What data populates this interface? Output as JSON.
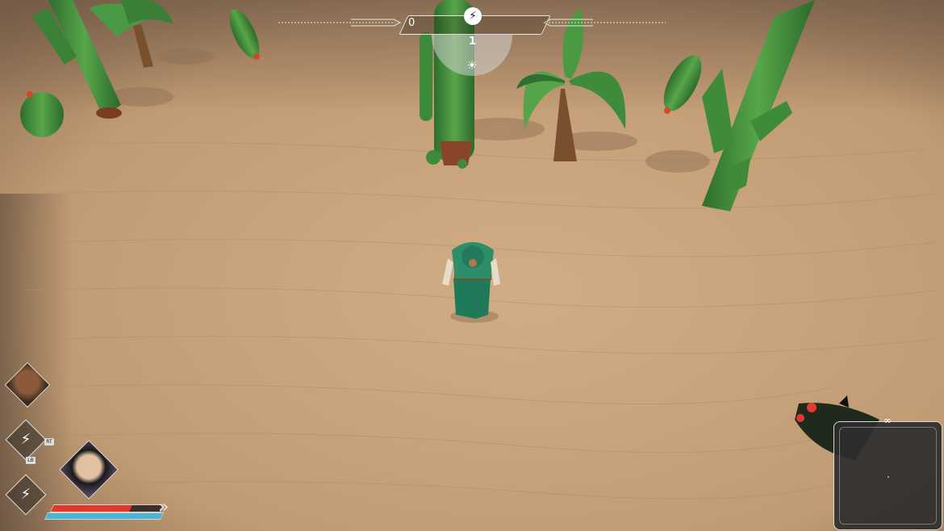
{
  "hud": {
    "energy_value": "0",
    "energy_icon": "lightning-icon",
    "day_value": "1",
    "time_icon": "sun-icon"
  },
  "party": {
    "leader_portrait": "character-portrait",
    "active_portrait": "character-portrait",
    "abilities": [
      {
        "icon": "claw-ability-icon",
        "key": "RT"
      },
      {
        "icon": "claw-ability-icon",
        "key": "LB"
      },
      {
        "icon": "claw-ability-icon",
        "key": ""
      }
    ],
    "health_fraction": 0.72,
    "mana_fraction": 1.0
  },
  "minimap": {
    "link_icon": "link-icon"
  },
  "colors": {
    "sand": "#c9a47c",
    "health": "#e0382f",
    "mana": "#49b6d8",
    "cactus": "#3f8a3a"
  }
}
